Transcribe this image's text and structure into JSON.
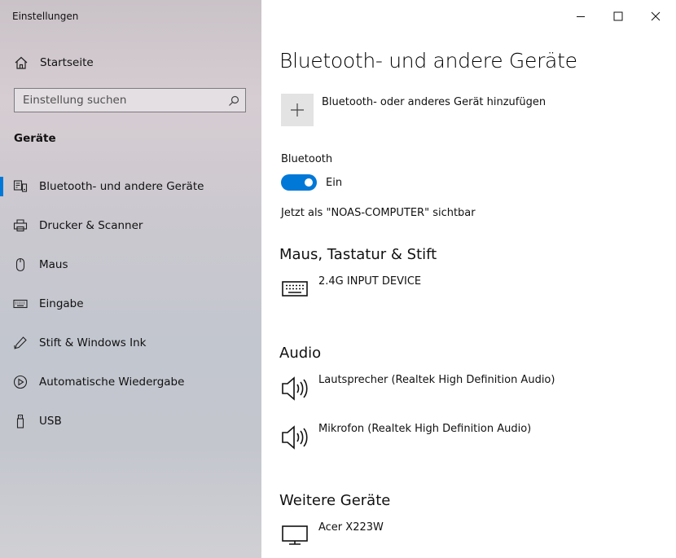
{
  "window": {
    "title": "Einstellungen"
  },
  "sidebar": {
    "home_label": "Startseite",
    "search_placeholder": "Einstellung suchen",
    "section_title": "Geräte",
    "items": [
      {
        "label": "Bluetooth- und andere Geräte",
        "icon": "bluetooth-devices-icon",
        "active": true
      },
      {
        "label": "Drucker & Scanner",
        "icon": "printer-icon",
        "active": false
      },
      {
        "label": "Maus",
        "icon": "mouse-icon",
        "active": false
      },
      {
        "label": "Eingabe",
        "icon": "keyboard-icon",
        "active": false
      },
      {
        "label": "Stift & Windows Ink",
        "icon": "pen-icon",
        "active": false
      },
      {
        "label": "Automatische Wiedergabe",
        "icon": "autoplay-icon",
        "active": false
      },
      {
        "label": "USB",
        "icon": "usb-icon",
        "active": false
      }
    ]
  },
  "main": {
    "title": "Bluetooth- und andere Geräte",
    "add_device_label": "Bluetooth- oder anderes Gerät hinzufügen",
    "bluetooth_label": "Bluetooth",
    "bluetooth_state": "Ein",
    "bluetooth_on": true,
    "visible_as": "Jetzt als \"NOAS-COMPUTER\" sichtbar",
    "groups": [
      {
        "title": "Maus, Tastatur & Stift",
        "devices": [
          {
            "name": "2.4G INPUT DEVICE",
            "icon": "keyboard-icon"
          }
        ]
      },
      {
        "title": "Audio",
        "devices": [
          {
            "name": "Lautsprecher (Realtek High Definition Audio)",
            "icon": "speaker-icon"
          },
          {
            "name": "Mikrofon (Realtek High Definition Audio)",
            "icon": "speaker-icon"
          }
        ]
      },
      {
        "title": "Weitere Geräte",
        "devices": [
          {
            "name": "Acer X223W",
            "icon": "monitor-icon"
          }
        ]
      }
    ]
  },
  "colors": {
    "accent": "#0078d7",
    "tile": "#e3e3e3"
  }
}
